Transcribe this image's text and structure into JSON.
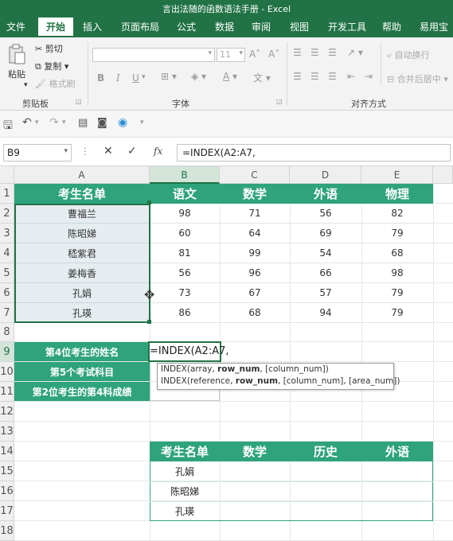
{
  "window": {
    "title": "言出法随的函数语法手册  -  Excel"
  },
  "tabs": [
    "文件",
    "开始",
    "插入",
    "页面布局",
    "公式",
    "数据",
    "审阅",
    "视图",
    "开发工具",
    "帮助",
    "易用宝"
  ],
  "ribbon": {
    "clipboard": {
      "paste": "粘贴",
      "cut": "剪切",
      "copy": "复制",
      "format_painter": "格式刷",
      "label": "剪贴板"
    },
    "font": {
      "size": "11",
      "bold": "B",
      "italic": "I",
      "underline": "U",
      "label": "字体"
    },
    "alignment": {
      "wrap": "自动换行",
      "merge": "合并后居中",
      "label": "对齐方式"
    }
  },
  "formula_bar": {
    "name_box": "B9",
    "fx": "fx",
    "formula": "=INDEX(A2:A7,"
  },
  "columns": [
    "A",
    "B",
    "C",
    "D",
    "E"
  ],
  "rows": [
    "1",
    "2",
    "3",
    "4",
    "5",
    "6",
    "7",
    "8",
    "9",
    "10",
    "11",
    "12",
    "13",
    "14",
    "15",
    "16",
    "17",
    "18"
  ],
  "table": {
    "headers": [
      "考生名单",
      "语文",
      "数学",
      "外语",
      "物理"
    ],
    "data": [
      [
        "曹福兰",
        "98",
        "71",
        "56",
        "82"
      ],
      [
        "陈昭娣",
        "60",
        "64",
        "69",
        "79"
      ],
      [
        "嵇紫君",
        "81",
        "99",
        "54",
        "68"
      ],
      [
        "姜梅香",
        "56",
        "96",
        "66",
        "98"
      ],
      [
        "孔娟",
        "73",
        "67",
        "57",
        "79"
      ],
      [
        "孔瑛",
        "86",
        "68",
        "94",
        "79"
      ]
    ]
  },
  "questions": [
    "第4位考生的姓名",
    "第5个考试科目",
    "第2位考生的第4科成绩"
  ],
  "editing_cell": "=INDEX(A2:A7,",
  "tooltip": {
    "line1": {
      "a": "INDEX(array, ",
      "b": "row_num",
      "c": ", [column_num])"
    },
    "line2": {
      "a": "INDEX(reference, ",
      "b": "row_num",
      "c": ", [column_num], [area_num])"
    }
  },
  "table2": {
    "headers": [
      "考生名单",
      "数学",
      "历史",
      "外语"
    ],
    "names": [
      "孔娟",
      "陈昭娣",
      "孔瑛"
    ]
  },
  "colors": {
    "excel_green": "#217346",
    "header_fill": "#2ea37c",
    "selection_fill": "#e6edf1"
  }
}
